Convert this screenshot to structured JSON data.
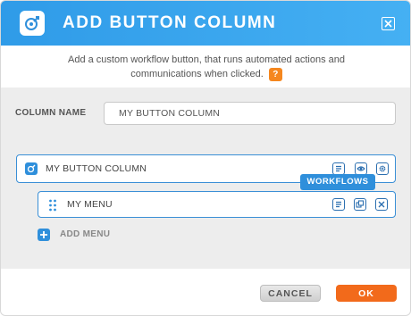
{
  "dialog": {
    "title": "ADD BUTTON COLUMN",
    "description": "Add a custom workflow button, that runs automated actions and communications when clicked.",
    "help_label": "?"
  },
  "form": {
    "column_name_label": "COLUMN NAME",
    "column_name_value": "MY BUTTON COLUMN"
  },
  "button_column": {
    "label": "MY BUTTON COLUMN",
    "tooltip": "WORKFLOWS"
  },
  "menu": {
    "label": "MY MENU"
  },
  "add_menu_label": "ADD MENU",
  "footer": {
    "cancel_label": "CANCEL",
    "ok_label": "OK"
  },
  "colors": {
    "header_blue": "#2f9be8",
    "accent_blue": "#2f8fdb",
    "ok_orange": "#f26a1b",
    "help_orange": "#f5871f"
  },
  "icons": {
    "header": "workflow-logo-icon",
    "close": "close-icon",
    "row": "workflow-icon",
    "drag": "drag-handle-icon",
    "workflow_tool": "workflow-list-icon",
    "view_tool": "eye-icon",
    "settings_tool": "gear-icon",
    "duplicate_tool": "duplicate-icon",
    "remove_tool": "remove-icon",
    "add": "plus-icon"
  }
}
